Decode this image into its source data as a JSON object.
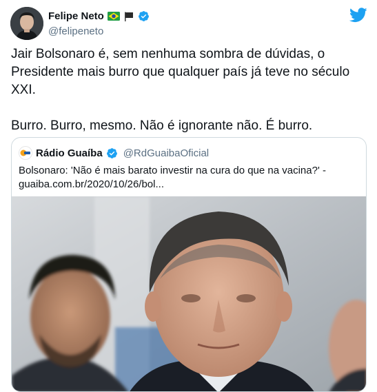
{
  "tweet": {
    "author": {
      "display_name": "Felipe Neto",
      "handle": "@felipeneto",
      "verified": true,
      "flags": [
        "brazil-flag",
        "black-flag"
      ]
    },
    "paragraphs": [
      "Jair Bolsonaro é, sem nenhuma sombra de dúvidas, o Presidente mais burro que qualquer país já teve no século XXI.",
      "Burro. Burro, mesmo. Não é ignorante não. É burro."
    ],
    "quoted": {
      "display_name": "Rádio Guaíba",
      "handle": "@RdGuaibaOficial",
      "verified": true,
      "text_line1": "Bolsonaro: 'Não é mais barato investir na cura do que na vacina?' -",
      "text_line2": "guaiba.com.br/2020/10/26/bol...",
      "image": "photo-of-men-outdoors"
    }
  },
  "icons": {
    "twitter_logo": "twitter-bird-icon",
    "verified_badge": "verified-badge-icon"
  },
  "colors": {
    "twitter_blue": "#1da1f2",
    "text": "#0f1419",
    "secondary_text": "#5b7083",
    "border": "#cfd9de"
  }
}
